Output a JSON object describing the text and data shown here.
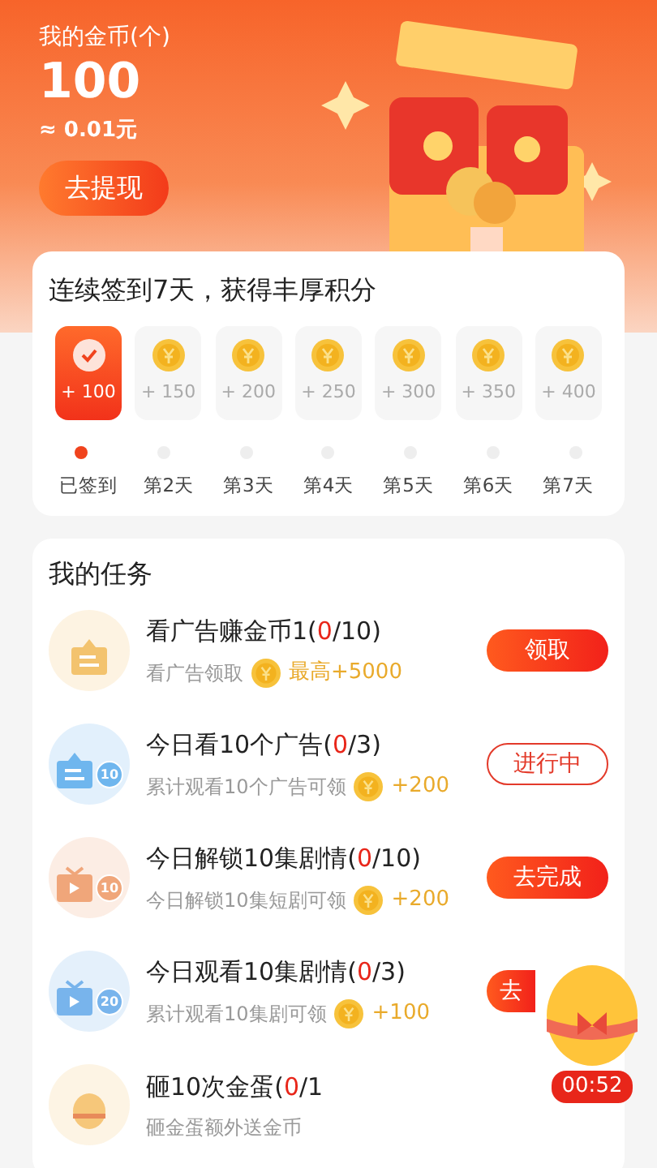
{
  "wallet": {
    "label": "我的金币(个)",
    "amount": "100",
    "equivalent": "≈ 0.01元",
    "button": "去提现"
  },
  "signin": {
    "title": "连续签到7天，获得丰厚积分",
    "days": [
      {
        "reward": "+ 100",
        "day": "已签到",
        "checked": true
      },
      {
        "reward": "+ 150",
        "day": "第2天",
        "checked": false
      },
      {
        "reward": "+ 200",
        "day": "第3天",
        "checked": false
      },
      {
        "reward": "+ 250",
        "day": "第4天",
        "checked": false
      },
      {
        "reward": "+ 300",
        "day": "第5天",
        "checked": false
      },
      {
        "reward": "+ 350",
        "day": "第6天",
        "checked": false
      },
      {
        "reward": "+ 400",
        "day": "第7天",
        "checked": false
      }
    ]
  },
  "tasks": {
    "title": "我的任务",
    "items": [
      {
        "icon": {
          "kind": "ad",
          "color": "#f3c36e"
        },
        "name": "看广告赚金币1(",
        "done": "0",
        "rest": "/10)",
        "desc": "看广告领取",
        "reward": "最高+5000",
        "button": {
          "label": "领取",
          "kind": "filled",
          "clipped": false
        }
      },
      {
        "icon": {
          "kind": "ad",
          "color": "#6fb6ee",
          "badge": "10"
        },
        "name": "今日看10个广告(",
        "done": "0",
        "rest": "/3)",
        "desc": "累计观看10个广告可领",
        "reward": "+200",
        "button": {
          "label": "进行中",
          "kind": "outline",
          "clipped": false
        }
      },
      {
        "icon": {
          "kind": "video",
          "color": "#f0a67a",
          "badge": "10"
        },
        "name": "今日解锁10集剧情(",
        "done": "0",
        "rest": "/10)",
        "desc": "今日解锁10集短剧可领",
        "reward": "+200",
        "button": {
          "label": "去完成",
          "kind": "filled",
          "clipped": false
        }
      },
      {
        "icon": {
          "kind": "video",
          "color": "#78b4ec",
          "badge": "20"
        },
        "name": "今日观看10集剧情(",
        "done": "0",
        "rest": "/3)",
        "desc": "累计观看10集剧可领",
        "reward": "+100",
        "button": {
          "label": "去",
          "kind": "filled",
          "clipped": true
        }
      },
      {
        "icon": {
          "kind": "egg",
          "color": "#f6c77a"
        },
        "name": "砸10次金蛋(",
        "done": "0",
        "rest": "/1",
        "desc": "砸金蛋额外送金币"
      }
    ]
  },
  "egg_timer": "00:52"
}
